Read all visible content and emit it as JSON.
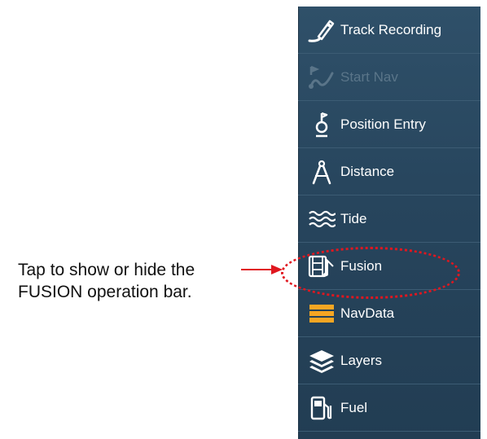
{
  "menu": {
    "items": [
      {
        "label": "Track Recording",
        "icon": "track-recording-icon",
        "enabled": true
      },
      {
        "label": "Start Nav",
        "icon": "start-nav-icon",
        "enabled": false
      },
      {
        "label": "Position Entry",
        "icon": "position-entry-icon",
        "enabled": true
      },
      {
        "label": "Distance",
        "icon": "distance-icon",
        "enabled": true
      },
      {
        "label": "Tide",
        "icon": "tide-icon",
        "enabled": true
      },
      {
        "label": "Fusion",
        "icon": "fusion-icon",
        "enabled": true
      },
      {
        "label": "NavData",
        "icon": "navdata-icon",
        "enabled": true
      },
      {
        "label": "Layers",
        "icon": "layers-icon",
        "enabled": true
      },
      {
        "label": "Fuel",
        "icon": "fuel-icon",
        "enabled": true
      }
    ]
  },
  "callout": {
    "text_line1": "Tap to show or hide the",
    "text_line2": "FUSION operation bar."
  },
  "colors": {
    "menu_background": "#27455d",
    "annotation": "#e0171f",
    "navdata_icon": "#f5a623",
    "disabled_text": "#5a7589"
  }
}
